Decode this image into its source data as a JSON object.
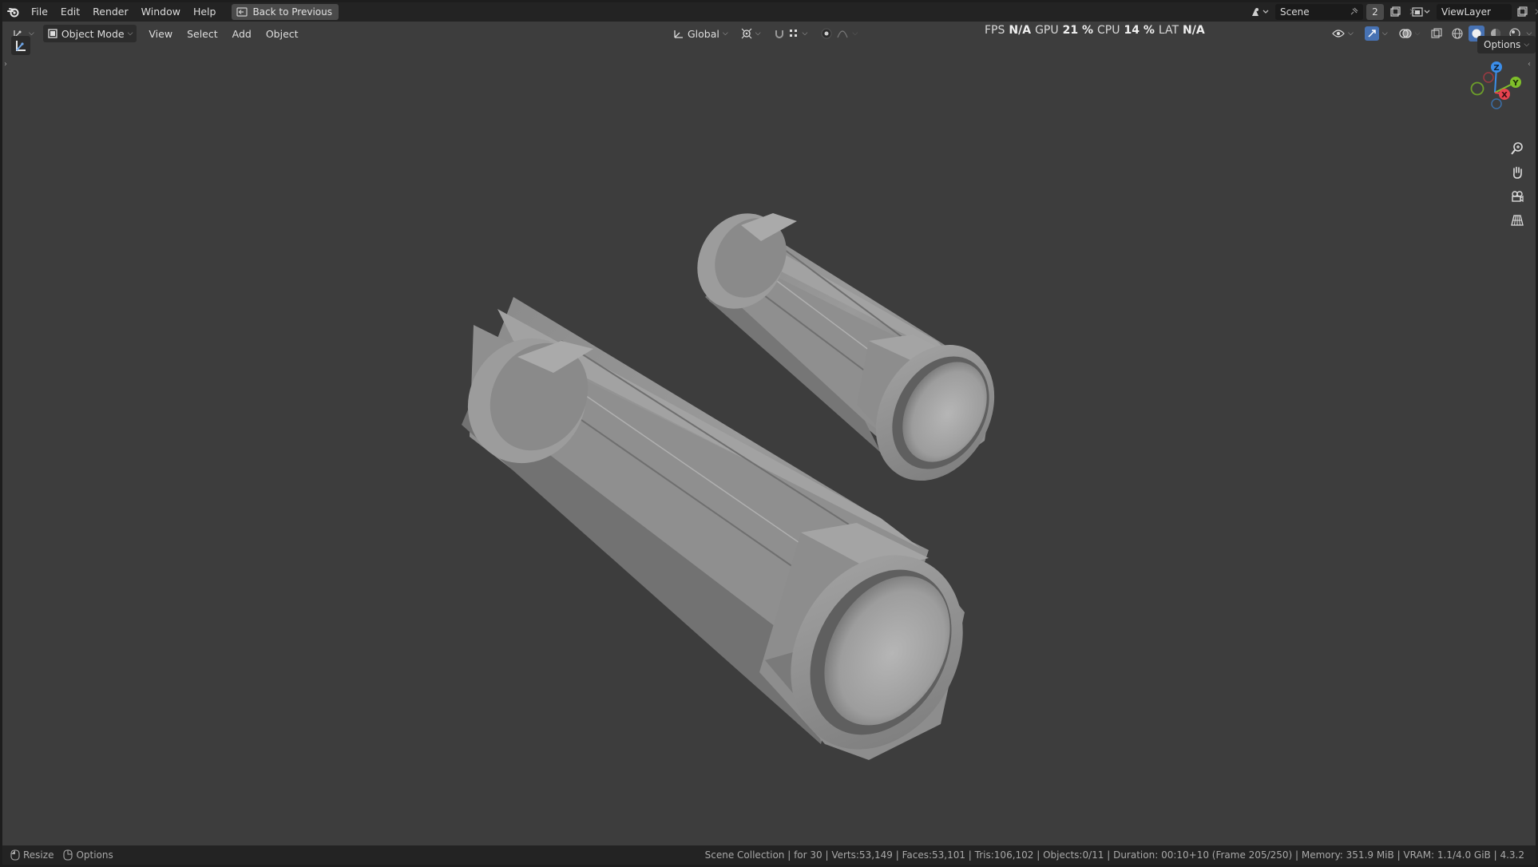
{
  "menu": {
    "file": "File",
    "edit": "Edit",
    "render": "Render",
    "window": "Window",
    "help": "Help",
    "back_button": "Back to Previous"
  },
  "scene": {
    "name": "Scene",
    "count": "2"
  },
  "view_layer": {
    "name": "ViewLayer"
  },
  "viewport_header": {
    "mode": "Object Mode",
    "view": "View",
    "select": "Select",
    "add": "Add",
    "object": "Object",
    "orientation": "Global",
    "options": "Options"
  },
  "stats": {
    "fps_label": "FPS",
    "fps_value": "N/A",
    "gpu_label": "GPU",
    "gpu_value": "21 %",
    "cpu_label": "CPU",
    "cpu_value": "14 %",
    "lat_label": "LAT",
    "lat_value": "N/A"
  },
  "gizmo": {
    "z": "Z",
    "y": "Y",
    "x": "X"
  },
  "statusbar": {
    "resize": "Resize",
    "options": "Options",
    "info": "Scene Collection | for 30 | Verts:53,149 | Faces:53,101 | Tris:106,102 | Objects:0/11 | Duration: 00:10+10 (Frame 205/250) | Memory: 351.9 MiB | VRAM: 1.1/4.0 GiB | 4.3.2"
  },
  "colors": {
    "viewport_bg": "#3d3d3d",
    "axis_x": "#e8434f",
    "axis_y": "#7fbf2a",
    "axis_z": "#3b8eea",
    "accent": "#4772b3"
  }
}
